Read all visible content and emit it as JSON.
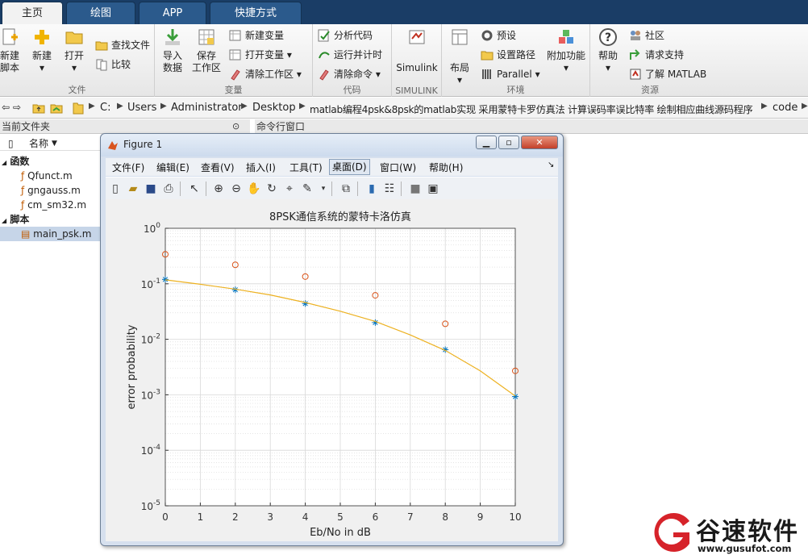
{
  "tabs": [
    "主页",
    "绘图",
    "APP",
    "快捷方式"
  ],
  "ribbon": {
    "file_group": "文件",
    "new_script": [
      "新建",
      "脚本"
    ],
    "new": "新建",
    "open": "打开",
    "find_files": "查找文件",
    "compare": "比较",
    "var_group": "变量",
    "import": [
      "导入",
      "数据"
    ],
    "save_ws": [
      "保存",
      "工作区"
    ],
    "new_var": "新建变量",
    "open_var": "打开变量",
    "clear_ws": "清除工作区",
    "code_group": "代码",
    "analyze": "分析代码",
    "run_time": "运行并计时",
    "clear_cmd": "清除命令",
    "simulink_group": "SIMULINK",
    "simulink": "Simulink",
    "env_group": "环境",
    "layout": "布局",
    "prefs": "预设",
    "set_path": "设置路径",
    "parallel": "Parallel",
    "addons": "附加功能",
    "res_group": "资源",
    "help": "帮助",
    "community": "社区",
    "support": "请求支持",
    "learn": "了解 MATLAB"
  },
  "path": [
    "C:",
    "Users",
    "Administrator",
    "Desktop",
    "matlab编程4psk&8psk的matlab实现 采用蒙特卡罗仿真法 计算误码率误比特率 绘制相应曲线源码程序",
    "code"
  ],
  "panes": {
    "current_folder": "当前文件夹",
    "command_window": "命令行窗口",
    "name_col": "名称"
  },
  "files": {
    "func_header": "函数",
    "funcs": [
      "Qfunct.m",
      "gngauss.m",
      "cm_sm32.m"
    ],
    "script_header": "脚本",
    "scripts": [
      "main_psk.m"
    ]
  },
  "figure": {
    "title": "Figure 1",
    "menu": [
      "文件(F)",
      "编辑(E)",
      "查看(V)",
      "插入(I)",
      "工具(T)",
      "桌面(D)",
      "窗口(W)",
      "帮助(H)"
    ]
  },
  "chart_data": {
    "type": "line",
    "title": "8PSK通信系统的蒙特卡洛仿真",
    "xlabel": "Eb/No in dB",
    "ylabel": "error probability",
    "x_ticks": [
      0,
      1,
      2,
      3,
      4,
      5,
      6,
      7,
      8,
      9,
      10
    ],
    "y_tick_exponents": [
      0,
      -1,
      -2,
      -3,
      -4,
      -5
    ],
    "xlim": [
      0,
      10
    ],
    "ylim": [
      1e-05,
      1
    ],
    "yscale": "log",
    "grid": true,
    "series": [
      {
        "marker": "o",
        "color": "#d95319",
        "x": [
          0,
          2,
          4,
          6,
          8,
          10
        ],
        "y": [
          0.34,
          0.22,
          0.135,
          0.062,
          0.019,
          0.0027
        ]
      },
      {
        "marker": "*",
        "color": "#0072bd",
        "x": [
          0,
          2,
          4,
          6,
          8,
          10
        ],
        "y": [
          0.12,
          0.078,
          0.044,
          0.02,
          0.0065,
          0.00093
        ]
      },
      {
        "marker": "line",
        "color": "#edb120",
        "x": [
          0,
          1,
          2,
          3,
          4,
          5,
          6,
          7,
          8,
          9,
          10
        ],
        "y": [
          0.118,
          0.098,
          0.08,
          0.063,
          0.046,
          0.032,
          0.021,
          0.012,
          0.0063,
          0.0027,
          0.00095
        ]
      }
    ]
  },
  "watermark": {
    "name": "谷速软件",
    "url": "www.gusufot.com"
  }
}
